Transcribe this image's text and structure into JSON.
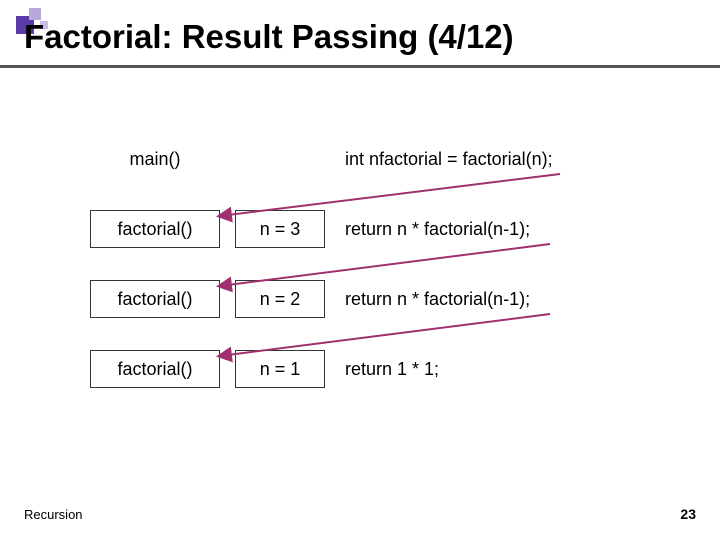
{
  "title": "Factorial: Result Passing (4/12)",
  "rows": [
    {
      "func": "main()",
      "state": "",
      "code": "int nfactorial = factorial(n);",
      "func_boxed": false,
      "show_state": false
    },
    {
      "func": "factorial()",
      "state": "n = 3",
      "code": "return n * factorial(n-1);",
      "func_boxed": true,
      "show_state": true
    },
    {
      "func": "factorial()",
      "state": "n = 2",
      "code": "return n * factorial(n-1);",
      "func_boxed": true,
      "show_state": true
    },
    {
      "func": "factorial()",
      "state": "n = 1",
      "code": "return 1 * 1;",
      "func_boxed": true,
      "show_state": true
    }
  ],
  "footer": {
    "label": "Recursion",
    "page": "23"
  },
  "colors": {
    "arrow": "#a03070"
  }
}
